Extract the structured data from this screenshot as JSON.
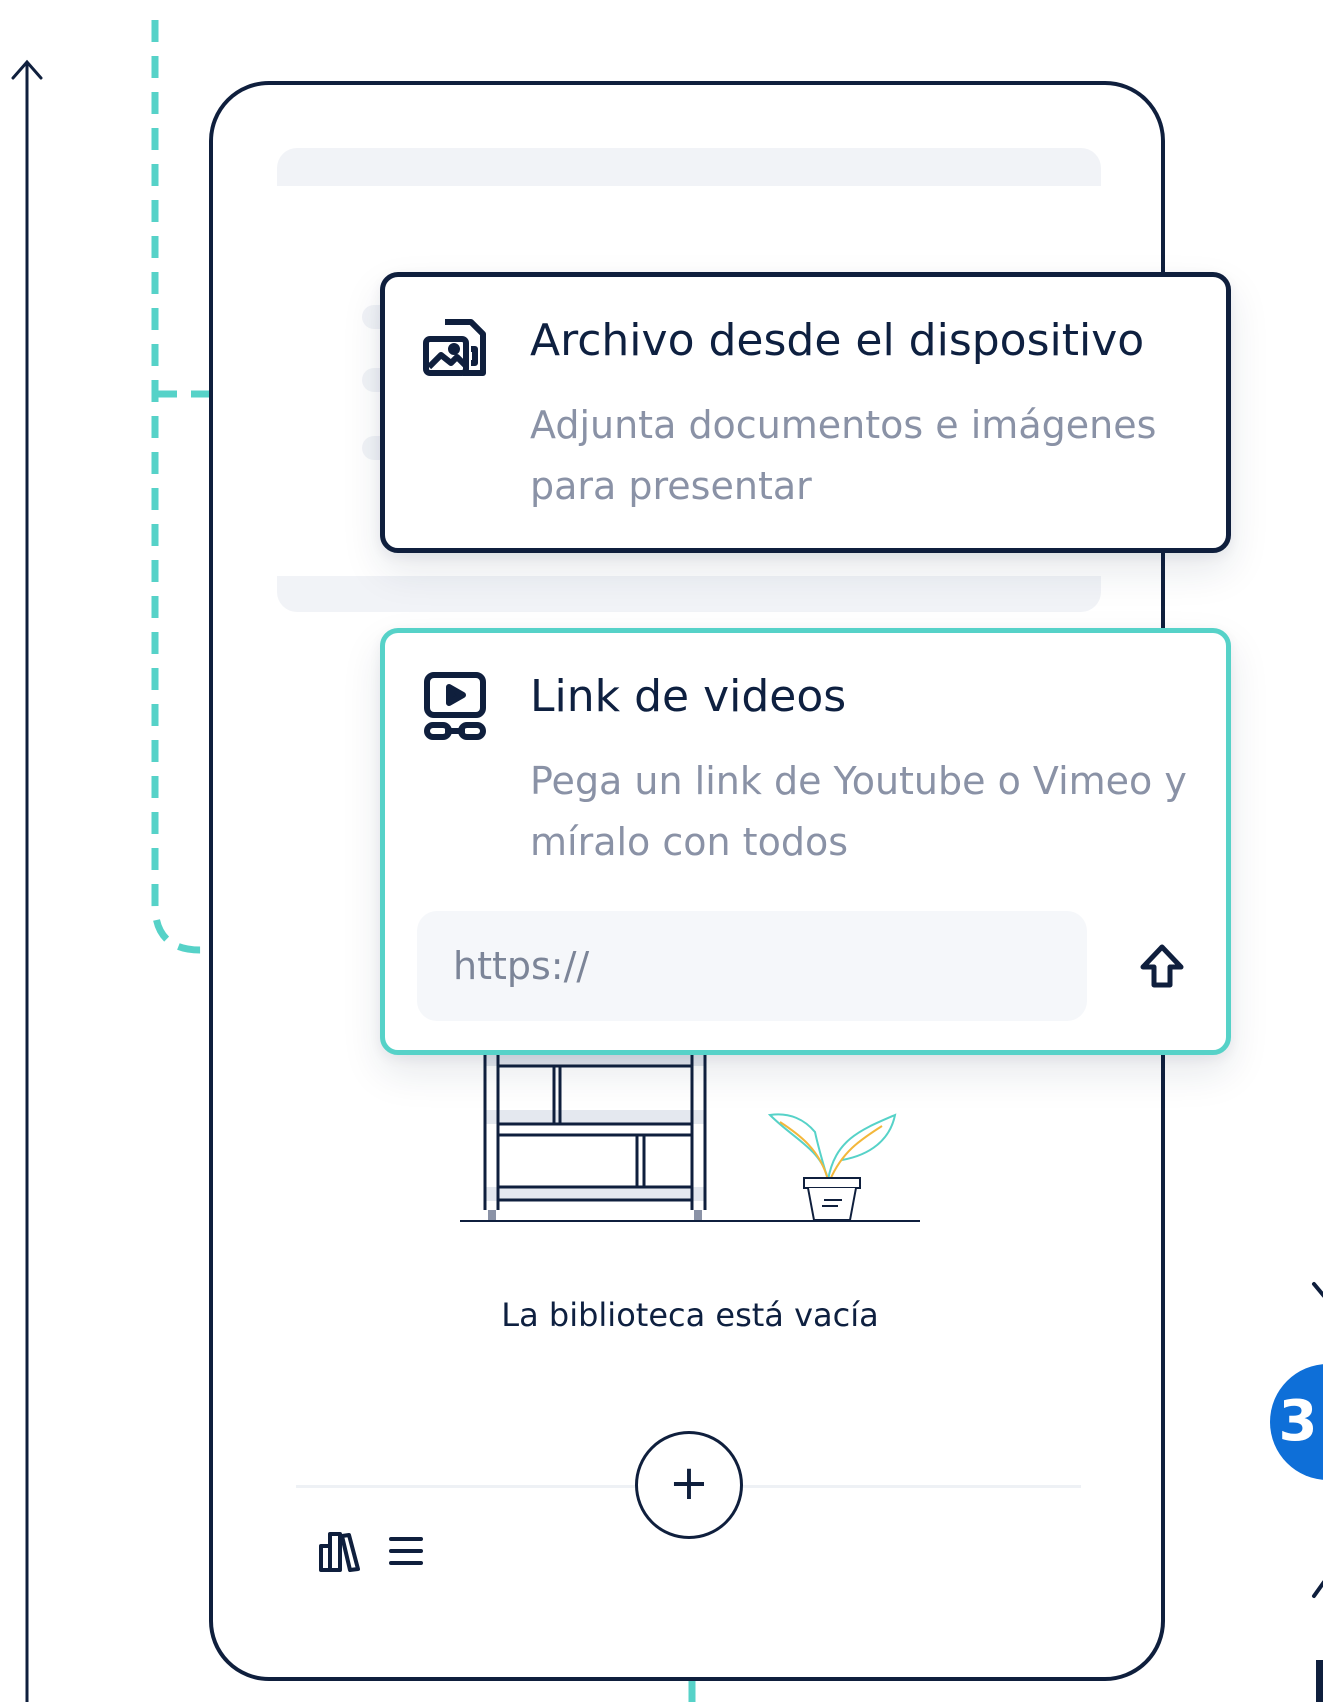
{
  "file_option": {
    "title": "Archivo desde el dispositivo",
    "description": "Adjunta documentos e imágenes para presentar",
    "icon": "image-file-icon"
  },
  "video_option": {
    "title": "Link de videos",
    "description": "Pega un link de Youtube o Vimeo y míralo con todos",
    "icon": "video-link-icon",
    "url_placeholder": "https://",
    "url_value": "",
    "submit_icon": "arrow-up-icon"
  },
  "library": {
    "empty_text": "La biblioteca está vacía",
    "add_button_label": "+"
  },
  "bottom_nav": {
    "library_icon": "books-icon",
    "menu_icon": "menu-icon"
  },
  "step_badge": {
    "label": "3"
  },
  "colors": {
    "navy": "#0f1f3d",
    "teal": "#56d2c8",
    "muted_text": "#8a92a6",
    "badge_blue": "#0e6fd8",
    "skeleton": "#f1f3f7"
  }
}
